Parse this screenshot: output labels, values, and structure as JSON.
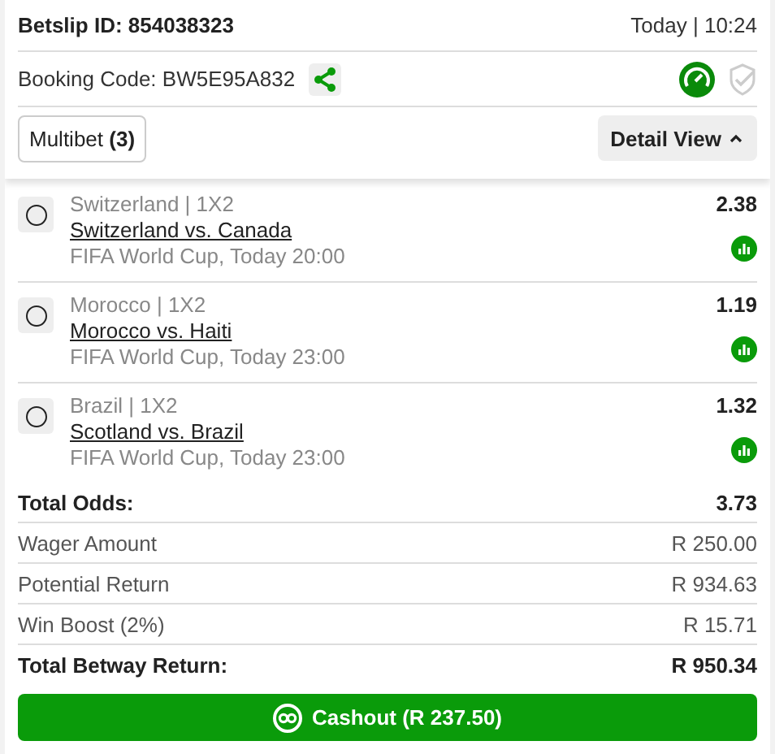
{
  "header": {
    "betslip_id": "Betslip ID: 854038323",
    "time": "Today | 10:24",
    "booking_code": "Booking Code: BW5E95A832",
    "multibet": "Multibet **(3)**",
    "detail_view": "Detail View",
    "detail_expanded": true
  },
  "selections": [
    {
      "market": "Switzerland | 1X2",
      "match": "Switzerland vs. Canada",
      "event": "FIFA World Cup, Today 20:00",
      "odds": "2.38",
      "selected": false
    },
    {
      "market": "Morocco | 1X2",
      "match": "Morocco vs. Haiti",
      "event": "FIFA World Cup, Today 23:00",
      "odds": "1.19",
      "selected": false
    },
    {
      "market": "Brazil | 1X2",
      "match": "Scotland vs. Brazil",
      "event": "FIFA World Cup, Today 23:00",
      "odds": "1.32",
      "selected": false
    }
  ],
  "summary": [
    {
      "kind": "total",
      "label": "Total Odds:",
      "value": "3.73"
    },
    {
      "kind": "line",
      "label": "Wager Amount",
      "value": "R 250.00"
    },
    {
      "kind": "line",
      "label": "Potential Return",
      "value": "R 934.63"
    },
    {
      "kind": "line",
      "label": "Win Boost (2%)",
      "value": "R 15.71"
    },
    {
      "kind": "total",
      "label": "Total Betway Return:",
      "value": "R 950.34"
    }
  ],
  "cashout": "Cashout (R 237.50)"
}
